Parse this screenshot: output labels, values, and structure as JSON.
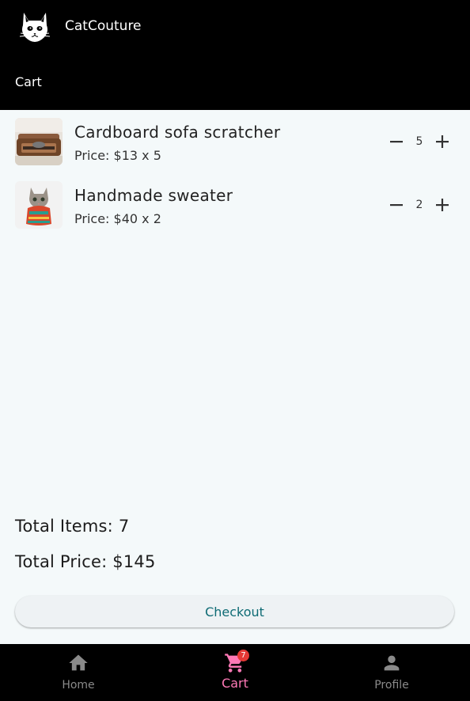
{
  "app": {
    "name": "CatCouture",
    "page_title": "Cart"
  },
  "cart": {
    "items": [
      {
        "name": "Cardboard sofa scratcher",
        "price_text": "Price: $13 x 5",
        "quantity": "5"
      },
      {
        "name": "Handmade sweater",
        "price_text": "Price: $40 x 2",
        "quantity": "2"
      }
    ],
    "total_items_text": "Total Items: 7",
    "total_price_text": "Total Price: $145",
    "checkout_label": "Checkout"
  },
  "nav": {
    "items": [
      {
        "label": "Home",
        "icon": "home-icon"
      },
      {
        "label": "Cart",
        "icon": "cart-icon",
        "badge": "7",
        "active": true
      },
      {
        "label": "Profile",
        "icon": "person-icon"
      }
    ]
  },
  "colors": {
    "app_bar": "#000000",
    "background": "#f4f9fa",
    "checkout_text": "#0e6b74",
    "active_nav": "#ff79b6",
    "badge": "#e53935"
  }
}
